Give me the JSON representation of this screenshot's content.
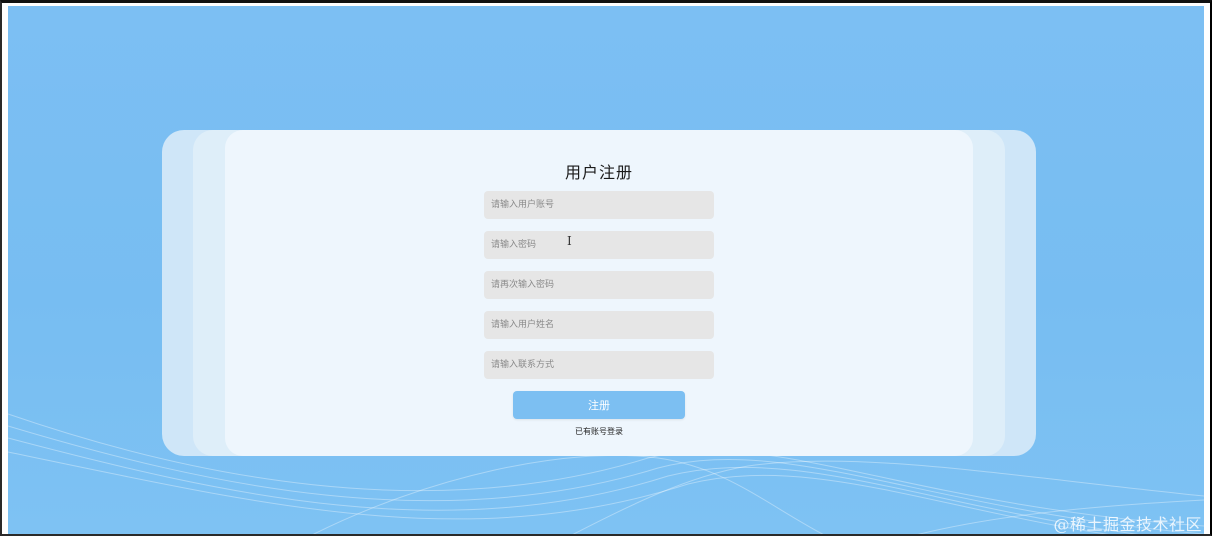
{
  "form": {
    "title": "用户注册",
    "fields": [
      {
        "placeholder": "请输入用户账号"
      },
      {
        "placeholder": "请输入密码"
      },
      {
        "placeholder": "请再次输入密码"
      },
      {
        "placeholder": "请输入用户姓名"
      },
      {
        "placeholder": "请输入联系方式"
      }
    ],
    "submit_label": "注册",
    "login_link": "已有账号登录"
  },
  "watermark": "@稀土掘金技术社区",
  "colors": {
    "background": "#77bdf2",
    "card": "#eef6fd",
    "field": "#e6e6e6",
    "button": "#7cbff2"
  },
  "icons": {
    "cursor": "text-cursor-icon"
  }
}
